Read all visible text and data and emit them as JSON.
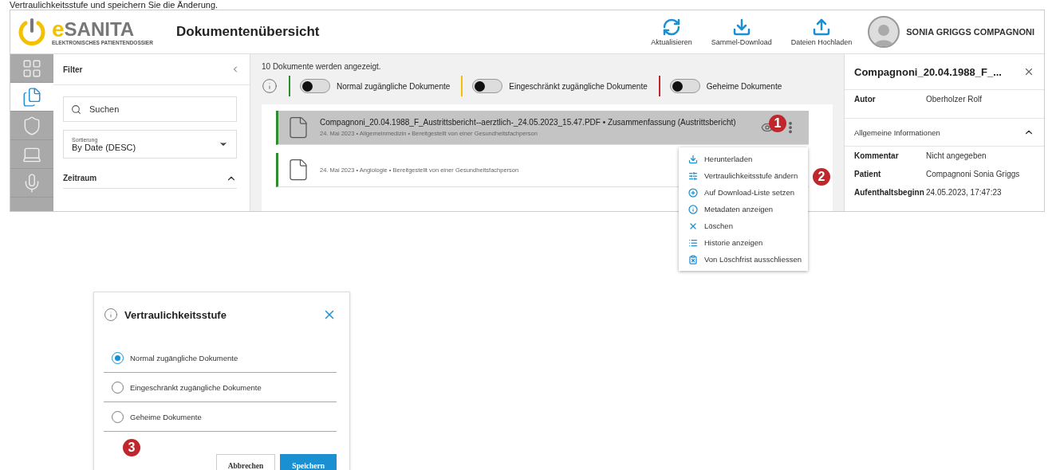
{
  "caption": "Vertraulichkeitsstufe und speichern Sie die Änderung.",
  "header": {
    "logo_mark": "e",
    "logo_name": "SANITA",
    "logo_tagline": "ELEKTRONISCHES PATIENTENDOSSIER",
    "title": "Dokumentenübersicht",
    "actions": [
      {
        "label": "Aktualisieren"
      },
      {
        "label": "Sammel-Download"
      },
      {
        "label": "Dateien Hochladen"
      }
    ],
    "user": "SONIA GRIGGS COMPAGNONI"
  },
  "rail": [
    {
      "selected": false
    },
    {
      "selected": true
    },
    {
      "selected": false
    },
    {
      "selected": false
    },
    {
      "selected": false
    }
  ],
  "filter": {
    "title": "Filter",
    "search_placeholder": "Suchen",
    "sort_label": "Sortierung",
    "sort_value": "By Date (DESC)",
    "section": "Zeitraum",
    "expanded": true
  },
  "main": {
    "count": "10 Dokumente werden angezeigt.",
    "toggles": [
      {
        "label": "Normal zugängliche Dokumente",
        "on": false,
        "color": "#2e8b2e"
      },
      {
        "label": "Eingeschränkt zugängliche Dokumente",
        "on": false,
        "color": "#f2c200"
      },
      {
        "label": "Geheime Dokumente",
        "on": false,
        "color": "#c0272d"
      }
    ],
    "documents": [
      {
        "title": "Compagnoni_20.04.1988_F_Austrittsbericht--aerztlich-_24.05.2023_15.47.PDF • Zusammenfassung (Austrittsbericht)",
        "meta": "24. Mai 2023 • Allgemeinmedizin • Bereitgestellt von einer Gesundheitsfachperson",
        "selected": true
      },
      {
        "meta": "24. Mai 2023 • Angiologie • Bereitgestellt von einer Gesundheitsfachperson",
        "selected": false
      }
    ]
  },
  "menu": [
    {
      "label": "Herunterladen"
    },
    {
      "label": "Vertraulichkeitsstufe ändern"
    },
    {
      "label": "Auf Download-Liste setzen"
    },
    {
      "label": "Metadaten anzeigen"
    },
    {
      "label": "Löschen"
    },
    {
      "label": "Historie anzeigen"
    },
    {
      "label": "Von Löschfrist ausschliessen"
    }
  ],
  "details": {
    "title": "Compagnoni_20.04.1988_F_...",
    "author_label": "Autor",
    "author": "Oberholzer Rolf",
    "section": "Allgemeine Informationen",
    "expanded": true,
    "fields": [
      {
        "label": "Kommentar",
        "value": "Nicht angegeben"
      },
      {
        "label": "Patient",
        "value": "Compagnoni Sonia Griggs"
      },
      {
        "label": "Aufenthaltsbeginn",
        "value": "24.05.2023, 17:47:23"
      }
    ]
  },
  "dialog": {
    "title": "Vertraulichkeitsstufe",
    "options": [
      {
        "label": "Normal zugängliche Dokumente",
        "selected": true
      },
      {
        "label": "Eingeschränkt zugängliche Dokumente",
        "selected": false
      },
      {
        "label": "Geheime Dokumente",
        "selected": false
      }
    ],
    "cancel": "Abbrechen",
    "save": "Speichern"
  },
  "callouts": [
    "1",
    "2",
    "3"
  ]
}
